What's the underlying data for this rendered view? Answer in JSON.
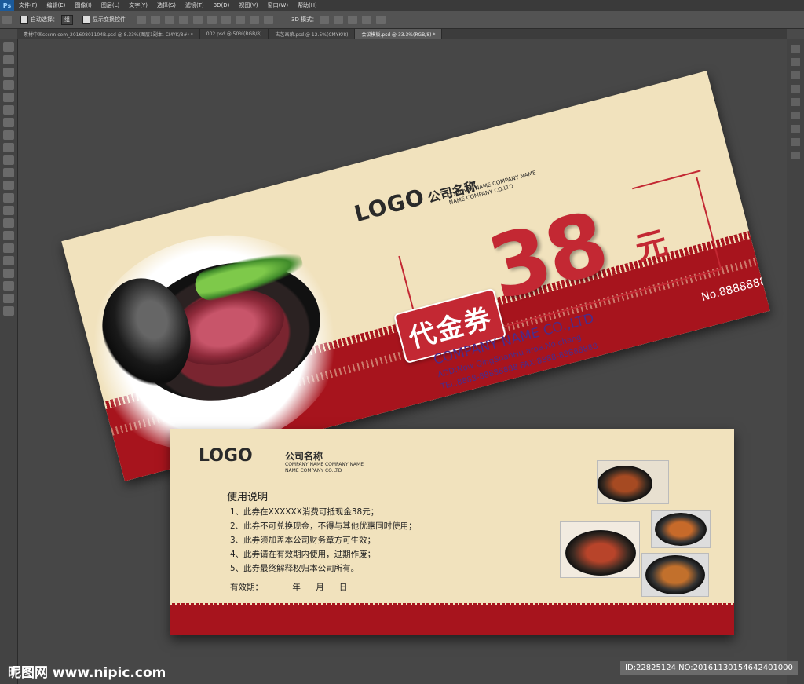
{
  "app": {
    "logo": "Ps",
    "menu": [
      "文件(F)",
      "编辑(E)",
      "图像(I)",
      "图层(L)",
      "文字(Y)",
      "选择(S)",
      "滤镜(T)",
      "3D(D)",
      "视图(V)",
      "窗口(W)",
      "帮助(H)"
    ],
    "options": {
      "auto_select_label": "自动选择：",
      "auto_select_value": "组",
      "show_transform_label": "显示变换控件",
      "mode_3d_label": "3D 模式："
    },
    "tabs": [
      {
        "label": "素材中国sccnn.com_20160801104B.psd @ 8.33%(图层1副本, CMYK/8#) *",
        "active": false
      },
      {
        "label": "002.psd @ 50%(RGB/8)",
        "active": false
      },
      {
        "label": "古艺画荣.psd @ 12.5%(CMYK/8)",
        "active": false
      },
      {
        "label": "会议模板.psd @ 33.3%(RGB/8) *",
        "active": true
      }
    ]
  },
  "front": {
    "logo": "LOGO",
    "company_cn": "公司名称",
    "company_en1": "COMPANY NAME COMPANY NAME",
    "company_en2": "NAME COMPANY CO.LTD",
    "voucher_label": "代金券",
    "amount": "38",
    "currency": "元",
    "company_name": "COMPANY NAME CO.,LTD",
    "address": "ADD:Now QingShanHu aroa.No.chang",
    "tel": "TEL:8888-88888888  FAX:8888-88888888",
    "number": "No.88888888"
  },
  "back": {
    "logo": "LOGO",
    "company_cn": "公司名称",
    "company_en1": "COMPANY NAME COMPANY NAME",
    "company_en2": "NAME COMPANY CO.LTD",
    "instructions_title": "使用说明",
    "rules": [
      "1、此券在XXXXXX消费可抵现金38元；",
      "2、此券不可兑换现金，不得与其他优惠同时使用；",
      "3、此券须加盖本公司财务章方可生效；",
      "4、此券请在有效期内使用，过期作废；",
      "5、此券最终解释权归本公司所有。"
    ],
    "validity_label": "有效期：",
    "year": "年",
    "month": "月",
    "day": "日"
  },
  "watermark": {
    "brand": "昵图网",
    "url": "www.nipic.com",
    "id_tag": "ID:22825124 NO:20161130154642401000"
  },
  "colors": {
    "brand_red": "#c32833",
    "band_red": "#a7141d",
    "cream": "#f1e2bd",
    "purple_text": "#4a2c8a"
  }
}
